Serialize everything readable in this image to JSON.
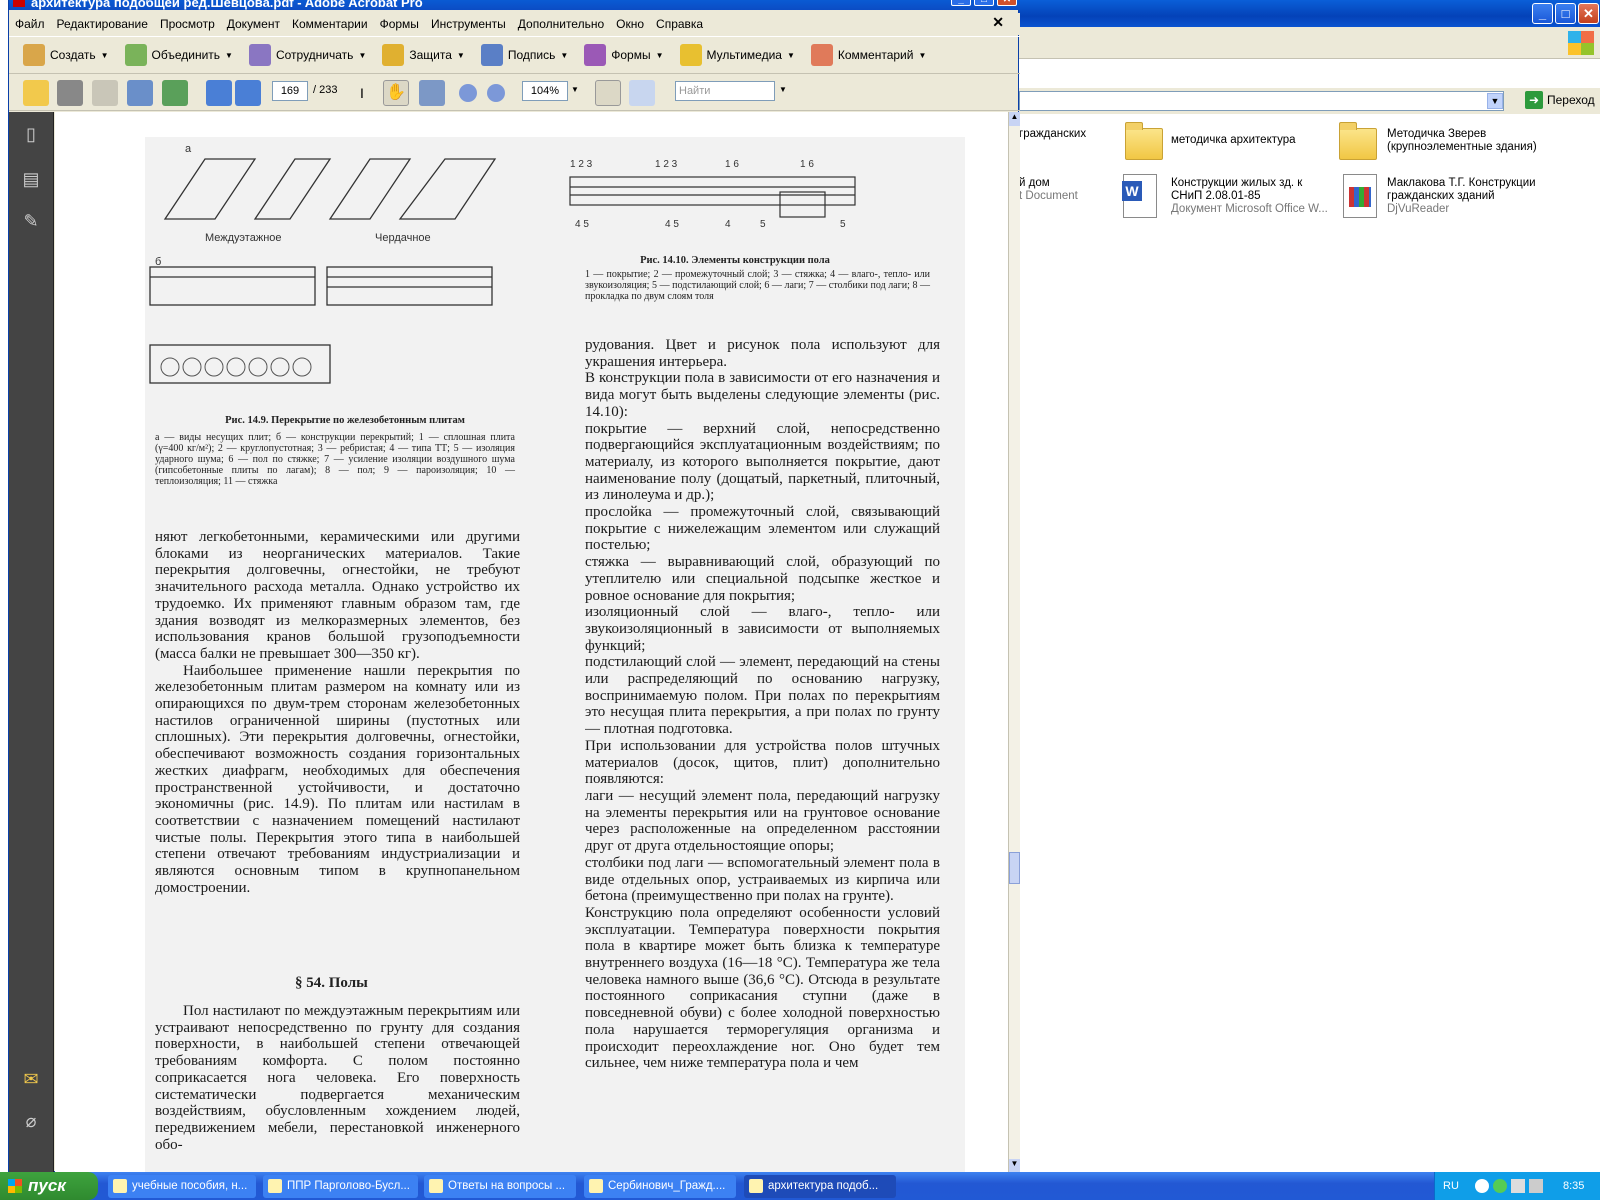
{
  "explorer": {
    "items": [
      {
        "name": "гражданских",
        "sub": ""
      },
      {
        "name": "методичка архитектура",
        "sub": ""
      },
      {
        "name": "Методичка Зверев (крупноэлементные здания)",
        "sub": ""
      },
      {
        "name": "й дом",
        "sub": "t Document"
      },
      {
        "name": "Конструкции жилых зд. к СНиП 2.08.01-85",
        "sub": "Документ Microsoft Office W..."
      },
      {
        "name": "Маклакова Т.Г. Конструкции гражданских зданий",
        "sub": "DjVuReader"
      }
    ],
    "go_label": "Переход"
  },
  "acrobat": {
    "title": "архитектура подобщей ред.Шевцова.pdf - Adobe Acrobat Pro",
    "menu": [
      "Файл",
      "Редактирование",
      "Просмотр",
      "Документ",
      "Комментарии",
      "Формы",
      "Инструменты",
      "Дополнительно",
      "Окно",
      "Справка"
    ],
    "tasks": [
      "Создать",
      "Объединить",
      "Сотрудничать",
      "Защита",
      "Подпись",
      "Формы",
      "Мультимедиа",
      "Комментарий"
    ],
    "page_current": "169",
    "page_total": "/ 233",
    "zoom": "104%",
    "find_placeholder": "Найти"
  },
  "document": {
    "fig1_labels": {
      "a": "а",
      "b": "б",
      "mezh": "Междуэтажное",
      "cherd": "Чердачное"
    },
    "fig1_caption": "Рис. 14.9. Перекрытие по железобетонным плитам",
    "fig1_legend": "а — виды несущих плит; б — конструкции перекрытий; 1 — сплошная плита (γ=400 кг/м²); 2 — круглопустотная; 3 — ребристая; 4 — типа ТТ; 5 — изоляция ударного шума; 6 — пол по стяжке; 7 — усиление изоляции воздушного шума (гипсобетонные плиты по лагам); 8 — пол; 9 — пароизоляция; 10 — теплоизоляция; 11 — стяжка",
    "fig2_caption": "Рис. 14.10. Элементы конструкции пола",
    "fig2_legend": "1 — покрытие; 2 — промежуточный слой; 3 — стяжка; 4 — влаго-, тепло- или звукоизоляция; 5 — подстилающий слой; 6 — лаги; 7 — столбики под лаги; 8 — прокладка по двум слоям толя",
    "left_col_1": "няют легкобетонными, керамическими или другими блоками из неорганических материалов. Такие перекрытия долговечны, огнестойки, не требуют значительного расхода металла. Однако устройство их трудоемко. Их применяют главным образом там, где здания возводят из мелкоразмерных элементов, без использования кранов большой грузоподъемности (масса балки не превышает 300—350 кг).",
    "left_col_2": "Наибольшее применение нашли перекрытия по железобетонным плитам размером на комнату или из опирающихся по двум-трем сторонам железобетонных настилов ограниченной ширины (пустотных или сплошных). Эти перекрытия долговечны, огнестойки, обеспечивают возможность создания горизонтальных жестких диафрагм, необходимых для обеспечения пространственной устойчивости, и достаточно экономичны (рис. 14.9). По плитам или настилам в соответствии с назначением помещений настилают чистые полы. Перекрытия этого типа в наибольшей степени отвечают требованиям индустриализации и являются основным типом в крупнопанельном домостроении.",
    "heading": "§ 54. Полы",
    "left_col_3": "Пол настилают по междуэтажным перекрытиям или устраивают непосредственно по грунту для создания поверхности, в наибольшей степени отвечающей требованиям комфорта. С полом постоянно соприкасается нога человека. Его поверхность систематически подвергается механическим воздействиям, обусловленным хождением людей, передвижением мебели, перестановкой инженерного обо-",
    "right_col": "рудования. Цвет и рисунок пола используют для украшения интерьера.\nВ конструкции пола в зависимости от его назначения и вида могут быть выделены следующие элементы (рис. 14.10):\nпокрытие — верхний слой, непосредственно подвергающийся эксплуатационным воздействиям; по материалу, из которого выполняется покрытие, дают наименование полу (дощатый, паркетный, плиточный, из линолеума и др.);\nпрослойка — промежуточный слой, связывающий покрытие с нижележащим элементом или служащий постелью;\nстяжка — выравнивающий слой, образующий по утеплителю или специальной подсыпке жесткое и ровное основание для покрытия;\nизоляционный слой — влаго-, тепло- или звукоизоляционный в зависимости от выполняемых функций;\nподстилающий слой — элемент, передающий на стены или распределяющий по основанию нагрузку, воспринимаемую полом. При полах по перекрытиям это несущая плита перекрытия, а при полах по грунту — плотная подготовка.\nПри использовании для устройства полов штучных материалов (досок, щитов, плит) дополнительно появляются:\nлаги — несущий элемент пола, передающий нагрузку на элементы перекрытия или на грунтовое основание через расположенные на определенном расстоянии друг от друга отдельностоящие опоры;\nстолбики под лаги — вспомогательный элемент пола в виде отдельных опор, устраиваемых из кирпича или бетона (преимущественно при полах на грунте).\nКонструкцию пола определяют особенности условий эксплуатации. Температура поверхности покрытия пола в квартире может быть близка к температуре внутреннего воздуха (16—18 °С). Температура же тела человека намного выше (36,6 °С). Отсюда в результате постоянного соприкасания ступни (даже в повседневной обуви) с более холодной поверхностью пола нарушается терморегуляция организма и происходит переохлаждение ног. Оно будет тем сильнее, чем ниже температура пола и чем"
  },
  "taskbar": {
    "start": "пуск",
    "items": [
      "учебные пособия, н...",
      "ППР Парголово-Бусл...",
      "Ответы на вопросы ...",
      "Сербинович_Гражд....",
      "архитектура подоб..."
    ],
    "lang": "RU",
    "time": "8:35"
  }
}
